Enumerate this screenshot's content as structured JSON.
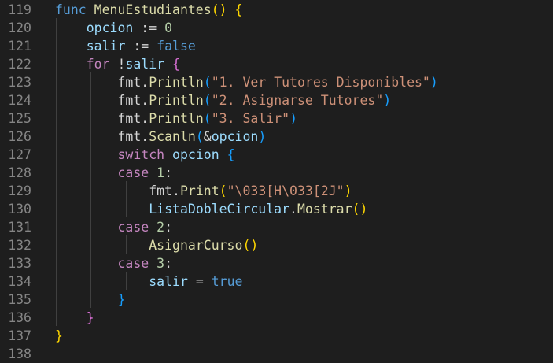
{
  "editor": {
    "lines": [
      {
        "num": "119",
        "tokens": [
          {
            "t": "func ",
            "c": "kw"
          },
          {
            "t": "MenuEstudiantes",
            "c": "fn"
          },
          {
            "t": "() ",
            "c": "b1"
          },
          {
            "t": "{",
            "c": "b1"
          }
        ]
      },
      {
        "num": "120",
        "tokens": [
          {
            "t": "    ",
            "c": "punc"
          },
          {
            "t": "opcion",
            "c": "var"
          },
          {
            "t": " := ",
            "c": "punc"
          },
          {
            "t": "0",
            "c": "num"
          }
        ]
      },
      {
        "num": "121",
        "tokens": [
          {
            "t": "    ",
            "c": "punc"
          },
          {
            "t": "salir",
            "c": "var"
          },
          {
            "t": " := ",
            "c": "punc"
          },
          {
            "t": "false",
            "c": "kw"
          }
        ]
      },
      {
        "num": "122",
        "tokens": [
          {
            "t": "    ",
            "c": "punc"
          },
          {
            "t": "for",
            "c": "ctrl"
          },
          {
            "t": " !",
            "c": "punc"
          },
          {
            "t": "salir",
            "c": "var"
          },
          {
            "t": " {",
            "c": "b2"
          }
        ]
      },
      {
        "num": "123",
        "tokens": [
          {
            "t": "        ",
            "c": "punc"
          },
          {
            "t": "fmt",
            "c": "pkg"
          },
          {
            "t": ".",
            "c": "punc"
          },
          {
            "t": "Println",
            "c": "fn"
          },
          {
            "t": "(",
            "c": "b3"
          },
          {
            "t": "\"1. Ver Tutores Disponibles\"",
            "c": "str"
          },
          {
            "t": ")",
            "c": "b3"
          }
        ]
      },
      {
        "num": "124",
        "tokens": [
          {
            "t": "        ",
            "c": "punc"
          },
          {
            "t": "fmt",
            "c": "pkg"
          },
          {
            "t": ".",
            "c": "punc"
          },
          {
            "t": "Println",
            "c": "fn"
          },
          {
            "t": "(",
            "c": "b3"
          },
          {
            "t": "\"2. Asignarse Tutores\"",
            "c": "str"
          },
          {
            "t": ")",
            "c": "b3"
          }
        ]
      },
      {
        "num": "125",
        "tokens": [
          {
            "t": "        ",
            "c": "punc"
          },
          {
            "t": "fmt",
            "c": "pkg"
          },
          {
            "t": ".",
            "c": "punc"
          },
          {
            "t": "Println",
            "c": "fn"
          },
          {
            "t": "(",
            "c": "b3"
          },
          {
            "t": "\"3. Salir\"",
            "c": "str"
          },
          {
            "t": ")",
            "c": "b3"
          }
        ]
      },
      {
        "num": "126",
        "tokens": [
          {
            "t": "        ",
            "c": "punc"
          },
          {
            "t": "fmt",
            "c": "pkg"
          },
          {
            "t": ".",
            "c": "punc"
          },
          {
            "t": "Scanln",
            "c": "fn"
          },
          {
            "t": "(",
            "c": "b3"
          },
          {
            "t": "&",
            "c": "punc"
          },
          {
            "t": "opcion",
            "c": "var"
          },
          {
            "t": ")",
            "c": "b3"
          }
        ]
      },
      {
        "num": "127",
        "tokens": [
          {
            "t": "        ",
            "c": "punc"
          },
          {
            "t": "switch",
            "c": "ctrl"
          },
          {
            "t": " opcion ",
            "c": "var"
          },
          {
            "t": "{",
            "c": "b3"
          }
        ]
      },
      {
        "num": "128",
        "tokens": [
          {
            "t": "        ",
            "c": "punc"
          },
          {
            "t": "case",
            "c": "ctrl"
          },
          {
            "t": " 1",
            "c": "num"
          },
          {
            "t": ":",
            "c": "punc"
          }
        ]
      },
      {
        "num": "129",
        "tokens": [
          {
            "t": "            ",
            "c": "punc"
          },
          {
            "t": "fmt",
            "c": "pkg"
          },
          {
            "t": ".",
            "c": "punc"
          },
          {
            "t": "Print",
            "c": "fn"
          },
          {
            "t": "(",
            "c": "b1"
          },
          {
            "t": "\"\\033[H\\033[2J\"",
            "c": "str"
          },
          {
            "t": ")",
            "c": "b1"
          }
        ]
      },
      {
        "num": "130",
        "tokens": [
          {
            "t": "            ",
            "c": "punc"
          },
          {
            "t": "ListaDobleCircular",
            "c": "var"
          },
          {
            "t": ".",
            "c": "punc"
          },
          {
            "t": "Mostrar",
            "c": "fn"
          },
          {
            "t": "()",
            "c": "b1"
          }
        ]
      },
      {
        "num": "131",
        "tokens": [
          {
            "t": "        ",
            "c": "punc"
          },
          {
            "t": "case",
            "c": "ctrl"
          },
          {
            "t": " 2",
            "c": "num"
          },
          {
            "t": ":",
            "c": "punc"
          }
        ]
      },
      {
        "num": "132",
        "tokens": [
          {
            "t": "            ",
            "c": "punc"
          },
          {
            "t": "AsignarCurso",
            "c": "fn"
          },
          {
            "t": "()",
            "c": "b1"
          }
        ]
      },
      {
        "num": "133",
        "tokens": [
          {
            "t": "        ",
            "c": "punc"
          },
          {
            "t": "case",
            "c": "ctrl"
          },
          {
            "t": " 3",
            "c": "num"
          },
          {
            "t": ":",
            "c": "punc"
          }
        ]
      },
      {
        "num": "134",
        "tokens": [
          {
            "t": "            ",
            "c": "punc"
          },
          {
            "t": "salir",
            "c": "var"
          },
          {
            "t": " = ",
            "c": "punc"
          },
          {
            "t": "true",
            "c": "kw"
          }
        ]
      },
      {
        "num": "135",
        "tokens": [
          {
            "t": "        ",
            "c": "punc"
          },
          {
            "t": "}",
            "c": "b3"
          }
        ]
      },
      {
        "num": "136",
        "tokens": [
          {
            "t": "    ",
            "c": "punc"
          },
          {
            "t": "}",
            "c": "b2"
          }
        ]
      },
      {
        "num": "137",
        "tokens": [
          {
            "t": "}",
            "c": "b1"
          }
        ]
      },
      {
        "num": "138",
        "tokens": []
      }
    ]
  },
  "colors": {
    "background": "#1e1e1e",
    "line_number": "#858585",
    "keyword": "#569cd6",
    "control": "#c586c0",
    "function": "#dcdcaa",
    "variable": "#9cdcfe",
    "string": "#ce9178",
    "number": "#b5cea8",
    "bracket_1": "#ffd700",
    "bracket_2": "#da70d6",
    "bracket_3": "#179fff"
  }
}
